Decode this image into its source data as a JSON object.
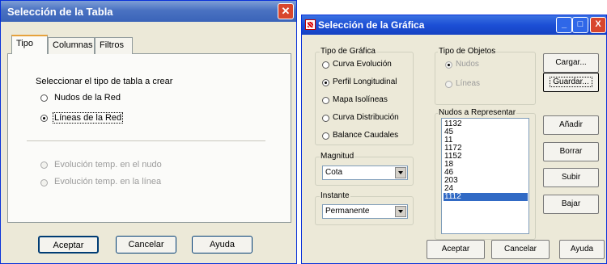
{
  "win1": {
    "title": "Selección de la Tabla",
    "close_icon": "close-icon",
    "tabs": [
      {
        "label": "Tipo",
        "selected": true
      },
      {
        "label": "Columnas",
        "selected": false
      },
      {
        "label": "Filtros",
        "selected": false
      }
    ],
    "prompt": "Seleccionar el tipo de tabla a crear",
    "options": [
      {
        "label": "Nudos de la Red",
        "checked": false,
        "enabled": true
      },
      {
        "label": "Líneas de la Red",
        "checked": true,
        "enabled": true
      },
      {
        "label": "Evolución temp. en el nudo",
        "checked": false,
        "enabled": false
      },
      {
        "label": "Evolución temp. en la línea",
        "checked": false,
        "enabled": false
      }
    ],
    "buttons": {
      "accept": "Aceptar",
      "cancel": "Cancelar",
      "help": "Ayuda"
    }
  },
  "win2": {
    "title": "Selección de la Gráfica",
    "app_icon": "chart-app-icon",
    "titlebar_buttons": {
      "minimize": "_",
      "maximize": "□",
      "close": "X"
    },
    "tipo_grafica": {
      "title": "Tipo de Gráfica",
      "options": [
        {
          "label": "Curva Evolución",
          "checked": false
        },
        {
          "label": "Perfil Longitudinal",
          "checked": true
        },
        {
          "label": "Mapa Isolíneas",
          "checked": false
        },
        {
          "label": "Curva Distribución",
          "checked": false
        },
        {
          "label": "Balance Caudales",
          "checked": false
        }
      ]
    },
    "magnitud": {
      "title": "Magnitud",
      "value": "Cota"
    },
    "instante": {
      "title": "Instante",
      "value": "Permanente"
    },
    "tipo_objetos": {
      "title": "Tipo de Objetos",
      "options": [
        {
          "label": "Nudos",
          "checked": true,
          "enabled": false
        },
        {
          "label": "Líneas",
          "checked": false,
          "enabled": false
        }
      ]
    },
    "nudos": {
      "title": "Nudos a Representar",
      "items": [
        "1132",
        "45",
        "11",
        "1172",
        "1152",
        "18",
        "46",
        "203",
        "24",
        "1112"
      ],
      "selected_index": 9
    },
    "side_buttons": {
      "cargar": "Cargar...",
      "guardar": "Guardar...",
      "anadir": "Añadir",
      "borrar": "Borrar",
      "subir": "Subir",
      "bajar": "Bajar"
    },
    "buttons": {
      "accept": "Aceptar",
      "cancel": "Cancelar",
      "help": "Ayuda"
    }
  }
}
